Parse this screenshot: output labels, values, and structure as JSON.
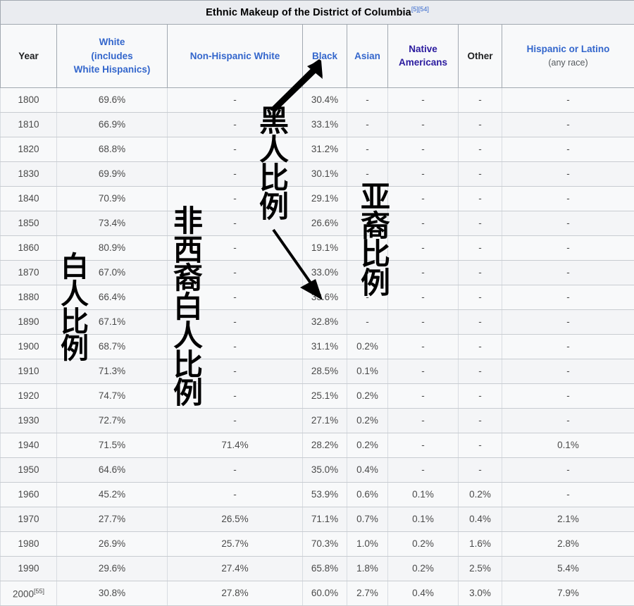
{
  "table": {
    "caption": "Ethnic Makeup of the District of Columbia",
    "caption_refs": "[5][54]",
    "columns": [
      {
        "id": "year",
        "lines": [
          "Year"
        ],
        "link": false
      },
      {
        "id": "white",
        "lines": [
          "White",
          "(includes",
          "White Hispanics)"
        ],
        "link": true
      },
      {
        "id": "nhw",
        "lines": [
          "Non-Hispanic White"
        ],
        "link": true
      },
      {
        "id": "black",
        "lines": [
          "Black"
        ],
        "link": true
      },
      {
        "id": "asian",
        "lines": [
          "Asian"
        ],
        "link": true
      },
      {
        "id": "native",
        "lines": [
          "Native",
          "Americans"
        ],
        "link": "visited"
      },
      {
        "id": "other",
        "lines": [
          "Other"
        ],
        "link": false
      },
      {
        "id": "hisp",
        "lines": [
          "Hispanic or Latino",
          "(any race)"
        ],
        "link": true
      }
    ],
    "header": {
      "year": "Year",
      "white_l1": "White",
      "white_l2": "(includes",
      "white_l3": "White Hispanics)",
      "non_hispanic_white": "Non-Hispanic White",
      "black": "Black",
      "asian": "Asian",
      "native_l1": "Native",
      "native_l2": "Americans",
      "other": "Other",
      "hispanic_l1": "Hispanic or Latino",
      "hispanic_l2": "(any race)"
    },
    "rows": [
      {
        "year": "1800",
        "year_ref": "",
        "white": "69.6%",
        "nhw": "-",
        "black": "30.4%",
        "asian": "-",
        "native": "-",
        "other": "-",
        "hisp": "-"
      },
      {
        "year": "1810",
        "year_ref": "",
        "white": "66.9%",
        "nhw": "-",
        "black": "33.1%",
        "asian": "-",
        "native": "-",
        "other": "-",
        "hisp": "-"
      },
      {
        "year": "1820",
        "year_ref": "",
        "white": "68.8%",
        "nhw": "-",
        "black": "31.2%",
        "asian": "-",
        "native": "-",
        "other": "-",
        "hisp": "-"
      },
      {
        "year": "1830",
        "year_ref": "",
        "white": "69.9%",
        "nhw": "-",
        "black": "30.1%",
        "asian": "-",
        "native": "-",
        "other": "-",
        "hisp": "-"
      },
      {
        "year": "1840",
        "year_ref": "",
        "white": "70.9%",
        "nhw": "-",
        "black": "29.1%",
        "asian": "-",
        "native": "-",
        "other": "-",
        "hisp": "-"
      },
      {
        "year": "1850",
        "year_ref": "",
        "white": "73.4%",
        "nhw": "-",
        "black": "26.6%",
        "asian": "-",
        "native": "-",
        "other": "-",
        "hisp": "-"
      },
      {
        "year": "1860",
        "year_ref": "",
        "white": "80.9%",
        "nhw": "-",
        "black": "19.1%",
        "asian": "-",
        "native": "-",
        "other": "-",
        "hisp": "-"
      },
      {
        "year": "1870",
        "year_ref": "",
        "white": "67.0%",
        "nhw": "-",
        "black": "33.0%",
        "asian": "-",
        "native": "-",
        "other": "-",
        "hisp": "-"
      },
      {
        "year": "1880",
        "year_ref": "",
        "white": "66.4%",
        "nhw": "-",
        "black": "33.6%",
        "asian": "-",
        "native": "-",
        "other": "-",
        "hisp": "-"
      },
      {
        "year": "1890",
        "year_ref": "",
        "white": "67.1%",
        "nhw": "-",
        "black": "32.8%",
        "asian": "-",
        "native": "-",
        "other": "-",
        "hisp": "-"
      },
      {
        "year": "1900",
        "year_ref": "",
        "white": "68.7%",
        "nhw": "-",
        "black": "31.1%",
        "asian": "0.2%",
        "native": "-",
        "other": "-",
        "hisp": "-"
      },
      {
        "year": "1910",
        "year_ref": "",
        "white": "71.3%",
        "nhw": "-",
        "black": "28.5%",
        "asian": "0.1%",
        "native": "-",
        "other": "-",
        "hisp": "-"
      },
      {
        "year": "1920",
        "year_ref": "",
        "white": "74.7%",
        "nhw": "-",
        "black": "25.1%",
        "asian": "0.2%",
        "native": "-",
        "other": "-",
        "hisp": "-"
      },
      {
        "year": "1930",
        "year_ref": "",
        "white": "72.7%",
        "nhw": "-",
        "black": "27.1%",
        "asian": "0.2%",
        "native": "-",
        "other": "-",
        "hisp": "-"
      },
      {
        "year": "1940",
        "year_ref": "",
        "white": "71.5%",
        "nhw": "71.4%",
        "black": "28.2%",
        "asian": "0.2%",
        "native": "-",
        "other": "-",
        "hisp": "0.1%"
      },
      {
        "year": "1950",
        "year_ref": "",
        "white": "64.6%",
        "nhw": "-",
        "black": "35.0%",
        "asian": "0.4%",
        "native": "-",
        "other": "-",
        "hisp": "-"
      },
      {
        "year": "1960",
        "year_ref": "",
        "white": "45.2%",
        "nhw": "-",
        "black": "53.9%",
        "asian": "0.6%",
        "native": "0.1%",
        "other": "0.2%",
        "hisp": "-"
      },
      {
        "year": "1970",
        "year_ref": "",
        "white": "27.7%",
        "nhw": "26.5%",
        "black": "71.1%",
        "asian": "0.7%",
        "native": "0.1%",
        "other": "0.4%",
        "hisp": "2.1%"
      },
      {
        "year": "1980",
        "year_ref": "",
        "white": "26.9%",
        "nhw": "25.7%",
        "black": "70.3%",
        "asian": "1.0%",
        "native": "0.2%",
        "other": "1.6%",
        "hisp": "2.8%"
      },
      {
        "year": "1990",
        "year_ref": "",
        "white": "29.6%",
        "nhw": "27.4%",
        "black": "65.8%",
        "asian": "1.8%",
        "native": "0.2%",
        "other": "2.5%",
        "hisp": "5.4%"
      },
      {
        "year": "2000",
        "year_ref": "[55]",
        "white": "30.8%",
        "nhw": "27.8%",
        "black": "60.0%",
        "asian": "2.7%",
        "native": "0.4%",
        "other": "3.0%",
        "hisp": "7.9%"
      }
    ]
  },
  "annotations": {
    "white_label": "白\n人\n比\n例",
    "non_hispanic_white_label": "非\n西\n裔\n白\n人\n比\n例",
    "black_label": "黑\n人\n比\n例",
    "asian_label": "亚\n裔\n比\n例"
  },
  "colors": {
    "link": "#3366cc",
    "link_visited": "#2a1a9e",
    "table_header_bg": "#f8f9fa",
    "caption_bg": "#eaecf0",
    "border": "#a2a9b1",
    "cell_text": "#4a4a4a",
    "annotation": "#000000"
  }
}
